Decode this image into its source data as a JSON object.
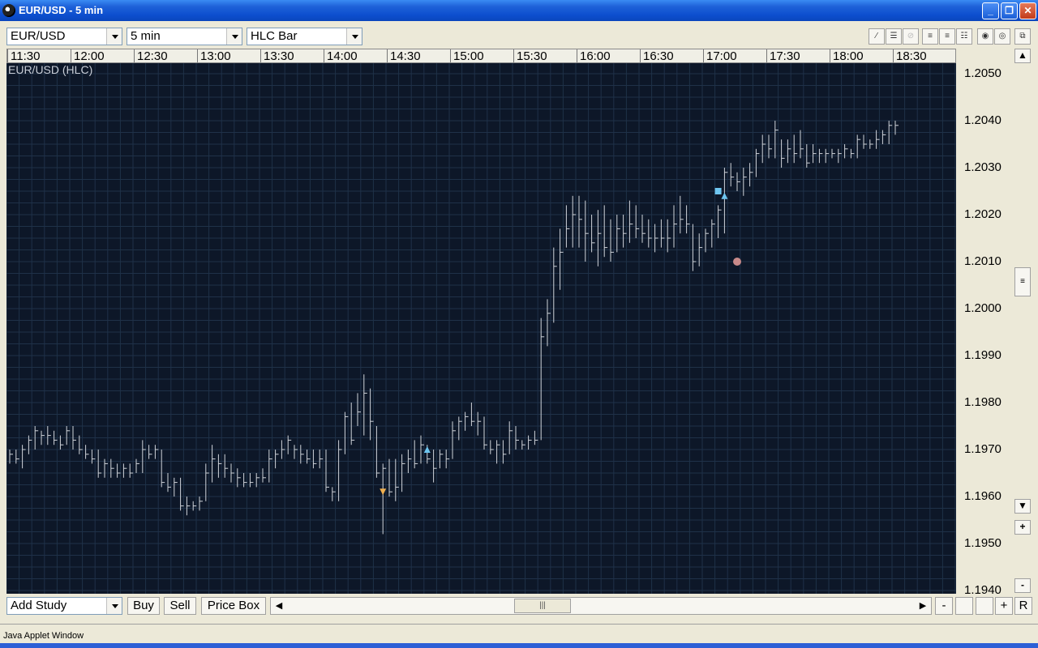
{
  "window": {
    "title": "EUR/USD  - 5 min"
  },
  "toolbar": {
    "symbol": "EUR/USD",
    "interval": "5 min",
    "chart_type": "HLC Bar"
  },
  "chart": {
    "label": "EUR/USD (HLC)",
    "time_labels": [
      "11:30",
      "12:00",
      "12:30",
      "13:00",
      "13:30",
      "14:00",
      "14:30",
      "15:00",
      "15:30",
      "16:00",
      "16:30",
      "17:00",
      "17:30",
      "18:00",
      "18:30"
    ],
    "price_labels": [
      "1.2050",
      "1.2040",
      "1.2030",
      "1.2020",
      "1.2010",
      "1.2000",
      "1.1990",
      "1.1980",
      "1.1970",
      "1.1960",
      "1.1950",
      "1.1940"
    ],
    "colors": {
      "background": "#0d1728",
      "grid": "#1f3148",
      "bars": "#d0d4da",
      "buy_marker": "#6ec6f0",
      "sell_marker": "#f0b050",
      "stop_marker": "#c88a8a"
    }
  },
  "chart_data": {
    "type": "hlc",
    "symbol": "EUR/USD",
    "interval": "5 min",
    "ylim": [
      1.194,
      1.2053
    ],
    "bars": [
      {
        "h": 1.197,
        "l": 1.1967,
        "c": 1.1969
      },
      {
        "h": 1.197,
        "l": 1.1967,
        "c": 1.1968
      },
      {
        "h": 1.1971,
        "l": 1.1966,
        "c": 1.197
      },
      {
        "h": 1.1973,
        "l": 1.1969,
        "c": 1.1972
      },
      {
        "h": 1.1975,
        "l": 1.197,
        "c": 1.1974
      },
      {
        "h": 1.1974,
        "l": 1.1971,
        "c": 1.1973
      },
      {
        "h": 1.1975,
        "l": 1.1971,
        "c": 1.1973
      },
      {
        "h": 1.1974,
        "l": 1.1971,
        "c": 1.1972
      },
      {
        "h": 1.1973,
        "l": 1.197,
        "c": 1.1971
      },
      {
        "h": 1.1975,
        "l": 1.1971,
        "c": 1.1974
      },
      {
        "h": 1.1975,
        "l": 1.197,
        "c": 1.1972
      },
      {
        "h": 1.1973,
        "l": 1.1969,
        "c": 1.197
      },
      {
        "h": 1.1971,
        "l": 1.1968,
        "c": 1.1969
      },
      {
        "h": 1.197,
        "l": 1.1967,
        "c": 1.1968
      },
      {
        "h": 1.197,
        "l": 1.1964,
        "c": 1.1965
      },
      {
        "h": 1.1968,
        "l": 1.1964,
        "c": 1.1967
      },
      {
        "h": 1.1968,
        "l": 1.1964,
        "c": 1.1966
      },
      {
        "h": 1.1967,
        "l": 1.1964,
        "c": 1.1965
      },
      {
        "h": 1.1967,
        "l": 1.1964,
        "c": 1.1966
      },
      {
        "h": 1.1967,
        "l": 1.1964,
        "c": 1.1965
      },
      {
        "h": 1.1968,
        "l": 1.1965,
        "c": 1.1967
      },
      {
        "h": 1.1972,
        "l": 1.1965,
        "c": 1.197
      },
      {
        "h": 1.1971,
        "l": 1.1968,
        "c": 1.1969
      },
      {
        "h": 1.1971,
        "l": 1.1968,
        "c": 1.197
      },
      {
        "h": 1.197,
        "l": 1.1962,
        "c": 1.1963
      },
      {
        "h": 1.1965,
        "l": 1.1961,
        "c": 1.1962
      },
      {
        "h": 1.1964,
        "l": 1.196,
        "c": 1.1963
      },
      {
        "h": 1.1964,
        "l": 1.1957,
        "c": 1.1958
      },
      {
        "h": 1.196,
        "l": 1.1956,
        "c": 1.1958
      },
      {
        "h": 1.1959,
        "l": 1.1957,
        "c": 1.1958
      },
      {
        "h": 1.196,
        "l": 1.1957,
        "c": 1.1959
      },
      {
        "h": 1.1967,
        "l": 1.1959,
        "c": 1.1965
      },
      {
        "h": 1.1971,
        "l": 1.1963,
        "c": 1.1968
      },
      {
        "h": 1.1969,
        "l": 1.1964,
        "c": 1.1967
      },
      {
        "h": 1.1969,
        "l": 1.1964,
        "c": 1.1966
      },
      {
        "h": 1.1967,
        "l": 1.1963,
        "c": 1.1965
      },
      {
        "h": 1.1966,
        "l": 1.1962,
        "c": 1.1964
      },
      {
        "h": 1.1965,
        "l": 1.1962,
        "c": 1.1963
      },
      {
        "h": 1.1965,
        "l": 1.1962,
        "c": 1.1963
      },
      {
        "h": 1.1965,
        "l": 1.1962,
        "c": 1.1964
      },
      {
        "h": 1.1966,
        "l": 1.1963,
        "c": 1.1964
      },
      {
        "h": 1.197,
        "l": 1.1963,
        "c": 1.1968
      },
      {
        "h": 1.197,
        "l": 1.1966,
        "c": 1.1969
      },
      {
        "h": 1.1972,
        "l": 1.1968,
        "c": 1.197
      },
      {
        "h": 1.1973,
        "l": 1.1969,
        "c": 1.1972
      },
      {
        "h": 1.1971,
        "l": 1.1968,
        "c": 1.197
      },
      {
        "h": 1.1971,
        "l": 1.1967,
        "c": 1.1969
      },
      {
        "h": 1.197,
        "l": 1.1967,
        "c": 1.1968
      },
      {
        "h": 1.197,
        "l": 1.1966,
        "c": 1.1967
      },
      {
        "h": 1.197,
        "l": 1.1966,
        "c": 1.1968
      },
      {
        "h": 1.197,
        "l": 1.1961,
        "c": 1.1962
      },
      {
        "h": 1.1962,
        "l": 1.1959,
        "c": 1.1961
      },
      {
        "h": 1.1972,
        "l": 1.1959,
        "c": 1.197
      },
      {
        "h": 1.1978,
        "l": 1.1969,
        "c": 1.1977
      },
      {
        "h": 1.198,
        "l": 1.1971,
        "c": 1.1972
      },
      {
        "h": 1.1982,
        "l": 1.1975,
        "c": 1.1978
      },
      {
        "h": 1.1986,
        "l": 1.1973,
        "c": 1.1982
      },
      {
        "h": 1.1983,
        "l": 1.1972,
        "c": 1.1976
      },
      {
        "h": 1.1975,
        "l": 1.1964,
        "c": 1.1965
      },
      {
        "h": 1.1967,
        "l": 1.1952,
        "c": 1.1966
      },
      {
        "h": 1.1968,
        "l": 1.196,
        "c": 1.1961
      },
      {
        "h": 1.1968,
        "l": 1.1959,
        "c": 1.1962
      },
      {
        "h": 1.1969,
        "l": 1.1961,
        "c": 1.1967
      },
      {
        "h": 1.197,
        "l": 1.1965,
        "c": 1.1968
      },
      {
        "h": 1.1972,
        "l": 1.1966,
        "c": 1.1967
      },
      {
        "h": 1.1973,
        "l": 1.1967,
        "c": 1.1971
      },
      {
        "h": 1.1971,
        "l": 1.1967,
        "c": 1.1968
      },
      {
        "h": 1.197,
        "l": 1.1963,
        "c": 1.1966
      },
      {
        "h": 1.197,
        "l": 1.1966,
        "c": 1.1969
      },
      {
        "h": 1.197,
        "l": 1.1966,
        "c": 1.1968
      },
      {
        "h": 1.1976,
        "l": 1.1968,
        "c": 1.1974
      },
      {
        "h": 1.1977,
        "l": 1.1972,
        "c": 1.1976
      },
      {
        "h": 1.1978,
        "l": 1.1974,
        "c": 1.1977
      },
      {
        "h": 1.198,
        "l": 1.1975,
        "c": 1.1976
      },
      {
        "h": 1.1978,
        "l": 1.1973,
        "c": 1.1976
      },
      {
        "h": 1.1977,
        "l": 1.197,
        "c": 1.1971
      },
      {
        "h": 1.1972,
        "l": 1.1969,
        "c": 1.197
      },
      {
        "h": 1.1972,
        "l": 1.1967,
        "c": 1.1971
      },
      {
        "h": 1.1972,
        "l": 1.1967,
        "c": 1.1969
      },
      {
        "h": 1.1976,
        "l": 1.1969,
        "c": 1.1974
      },
      {
        "h": 1.1975,
        "l": 1.197,
        "c": 1.1972
      },
      {
        "h": 1.1972,
        "l": 1.197,
        "c": 1.1971
      },
      {
        "h": 1.1973,
        "l": 1.197,
        "c": 1.1972
      },
      {
        "h": 1.1974,
        "l": 1.1971,
        "c": 1.1972
      },
      {
        "h": 1.1998,
        "l": 1.1972,
        "c": 1.1994
      },
      {
        "h": 1.2002,
        "l": 1.1992,
        "c": 1.1999
      },
      {
        "h": 1.2013,
        "l": 1.1997,
        "c": 1.2009
      },
      {
        "h": 1.2017,
        "l": 1.2004,
        "c": 1.2012
      },
      {
        "h": 1.2022,
        "l": 1.2013,
        "c": 1.2017
      },
      {
        "h": 1.2024,
        "l": 1.2013,
        "c": 1.202
      },
      {
        "h": 1.2024,
        "l": 1.2013,
        "c": 1.2019
      },
      {
        "h": 1.2023,
        "l": 1.201,
        "c": 1.2016
      },
      {
        "h": 1.202,
        "l": 1.2012,
        "c": 1.2014
      },
      {
        "h": 1.2021,
        "l": 1.2009,
        "c": 1.2016
      },
      {
        "h": 1.2022,
        "l": 1.2011,
        "c": 1.2013
      },
      {
        "h": 1.2019,
        "l": 1.201,
        "c": 1.2012
      },
      {
        "h": 1.202,
        "l": 1.2012,
        "c": 1.2017
      },
      {
        "h": 1.202,
        "l": 1.2013,
        "c": 1.2016
      },
      {
        "h": 1.2023,
        "l": 1.2014,
        "c": 1.2018
      },
      {
        "h": 1.2022,
        "l": 1.2015,
        "c": 1.2017
      },
      {
        "h": 1.202,
        "l": 1.2014,
        "c": 1.2016
      },
      {
        "h": 1.2019,
        "l": 1.2013,
        "c": 1.2015
      },
      {
        "h": 1.2018,
        "l": 1.2012,
        "c": 1.2015
      },
      {
        "h": 1.2019,
        "l": 1.2013,
        "c": 1.2015
      },
      {
        "h": 1.2019,
        "l": 1.2012,
        "c": 1.2015
      },
      {
        "h": 1.2022,
        "l": 1.2013,
        "c": 1.2018
      },
      {
        "h": 1.2024,
        "l": 1.2016,
        "c": 1.2019
      },
      {
        "h": 1.2022,
        "l": 1.2016,
        "c": 1.2018
      },
      {
        "h": 1.2018,
        "l": 1.2008,
        "c": 1.201
      },
      {
        "h": 1.2016,
        "l": 1.2009,
        "c": 1.2013
      },
      {
        "h": 1.2017,
        "l": 1.2012,
        "c": 1.2016
      },
      {
        "h": 1.2019,
        "l": 1.2013,
        "c": 1.2018
      },
      {
        "h": 1.2022,
        "l": 1.2015,
        "c": 1.2021
      },
      {
        "h": 1.203,
        "l": 1.2016,
        "c": 1.2029
      },
      {
        "h": 1.2031,
        "l": 1.2026,
        "c": 1.2028
      },
      {
        "h": 1.2029,
        "l": 1.2025,
        "c": 1.2027
      },
      {
        "h": 1.203,
        "l": 1.2024,
        "c": 1.2028
      },
      {
        "h": 1.2031,
        "l": 1.2026,
        "c": 1.2029
      },
      {
        "h": 1.2034,
        "l": 1.2028,
        "c": 1.2033
      },
      {
        "h": 1.2037,
        "l": 1.2031,
        "c": 1.2035
      },
      {
        "h": 1.2037,
        "l": 1.2032,
        "c": 1.2034
      },
      {
        "h": 1.204,
        "l": 1.2032,
        "c": 1.2038
      },
      {
        "h": 1.2036,
        "l": 1.203,
        "c": 1.2032
      },
      {
        "h": 1.2036,
        "l": 1.2031,
        "c": 1.2034
      },
      {
        "h": 1.2037,
        "l": 1.2031,
        "c": 1.2033
      },
      {
        "h": 1.2038,
        "l": 1.2032,
        "c": 1.2034
      },
      {
        "h": 1.2035,
        "l": 1.203,
        "c": 1.2031
      },
      {
        "h": 1.2035,
        "l": 1.2031,
        "c": 1.2033
      },
      {
        "h": 1.2034,
        "l": 1.2031,
        "c": 1.2033
      },
      {
        "h": 1.2034,
        "l": 1.2031,
        "c": 1.2033
      },
      {
        "h": 1.2034,
        "l": 1.2032,
        "c": 1.2033
      },
      {
        "h": 1.2034,
        "l": 1.2031,
        "c": 1.2033
      },
      {
        "h": 1.2035,
        "l": 1.2032,
        "c": 1.2034
      },
      {
        "h": 1.2034,
        "l": 1.2032,
        "c": 1.2033
      },
      {
        "h": 1.2037,
        "l": 1.2032,
        "c": 1.2036
      },
      {
        "h": 1.2037,
        "l": 1.2034,
        "c": 1.2035
      },
      {
        "h": 1.2036,
        "l": 1.2034,
        "c": 1.2035
      },
      {
        "h": 1.2038,
        "l": 1.2034,
        "c": 1.2036
      },
      {
        "h": 1.2038,
        "l": 1.2035,
        "c": 1.2037
      },
      {
        "h": 1.204,
        "l": 1.2035,
        "c": 1.2039
      },
      {
        "h": 1.204,
        "l": 1.2037,
        "c": 1.2039
      }
    ],
    "markers": [
      {
        "type": "sell",
        "bar": 59,
        "price": 1.1961
      },
      {
        "type": "buy",
        "bar": 66,
        "price": 1.197
      },
      {
        "type": "buy",
        "bar": 113,
        "price": 1.2024
      },
      {
        "type": "square",
        "bar": 112,
        "price": 1.2025
      },
      {
        "type": "stop",
        "bar": 115,
        "price": 1.201
      }
    ]
  },
  "bottom": {
    "add_study": "Add Study",
    "buy": "Buy",
    "sell": "Sell",
    "price_box": "Price Box",
    "minus": "-",
    "plus": "+",
    "reset": "R"
  },
  "statusbar": {
    "text": "Java Applet Window"
  }
}
